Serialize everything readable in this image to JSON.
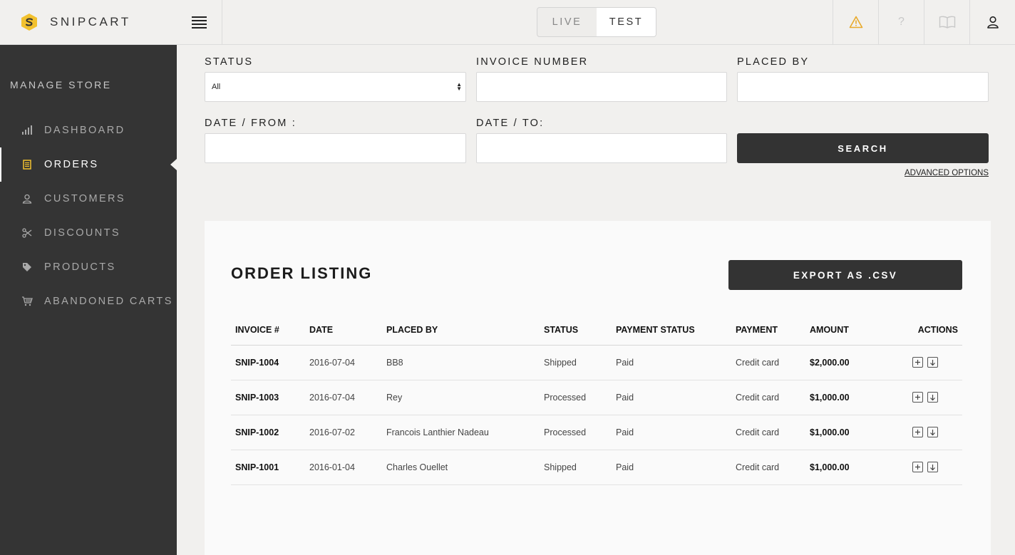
{
  "brand": {
    "name": "SNIPCART",
    "accent": "#f2c12e"
  },
  "sidebar": {
    "section_title": "MANAGE STORE",
    "items": [
      {
        "label": "DASHBOARD",
        "icon": "bar-chart-icon"
      },
      {
        "label": "ORDERS",
        "icon": "receipt-icon",
        "active": true
      },
      {
        "label": "CUSTOMERS",
        "icon": "user-icon"
      },
      {
        "label": "DISCOUNTS",
        "icon": "scissors-icon"
      },
      {
        "label": "PRODUCTS",
        "icon": "tag-icon"
      },
      {
        "label": "ABANDONED CARTS",
        "icon": "cart-icon"
      }
    ]
  },
  "topbar": {
    "env": {
      "live": "LIVE",
      "test": "TEST",
      "selected": "TEST"
    },
    "icons": [
      "warning-icon",
      "help-icon",
      "book-icon",
      "account-icon"
    ]
  },
  "filters": {
    "status_label": "STATUS",
    "status_value": "All",
    "invoice_label": "INVOICE NUMBER",
    "invoice_value": "",
    "placed_by_label": "PLACED BY",
    "placed_by_value": "",
    "date_from_label": "DATE / FROM :",
    "date_from_value": "",
    "date_to_label": "DATE / TO:",
    "date_to_value": "",
    "search_label": "SEARCH",
    "advanced_label": "ADVANCED OPTIONS"
  },
  "listing": {
    "title": "ORDER LISTING",
    "export_label": "EXPORT AS .CSV",
    "columns": [
      "INVOICE #",
      "DATE",
      "PLACED BY",
      "STATUS",
      "PAYMENT STATUS",
      "PAYMENT",
      "AMOUNT",
      "ACTIONS"
    ],
    "rows": [
      {
        "invoice": "SNIP-1004",
        "date": "2016-07-04",
        "placed_by": "BB8",
        "status": "Shipped",
        "payment_status": "Paid",
        "payment": "Credit card",
        "amount": "$2,000.00"
      },
      {
        "invoice": "SNIP-1003",
        "date": "2016-07-04",
        "placed_by": "Rey",
        "status": "Processed",
        "payment_status": "Paid",
        "payment": "Credit card",
        "amount": "$1,000.00"
      },
      {
        "invoice": "SNIP-1002",
        "date": "2016-07-02",
        "placed_by": "Francois Lanthier Nadeau",
        "status": "Processed",
        "payment_status": "Paid",
        "payment": "Credit card",
        "amount": "$1,000.00"
      },
      {
        "invoice": "SNIP-1001",
        "date": "2016-01-04",
        "placed_by": "Charles Ouellet",
        "status": "Shipped",
        "payment_status": "Paid",
        "payment": "Credit card",
        "amount": "$1,000.00"
      }
    ]
  }
}
